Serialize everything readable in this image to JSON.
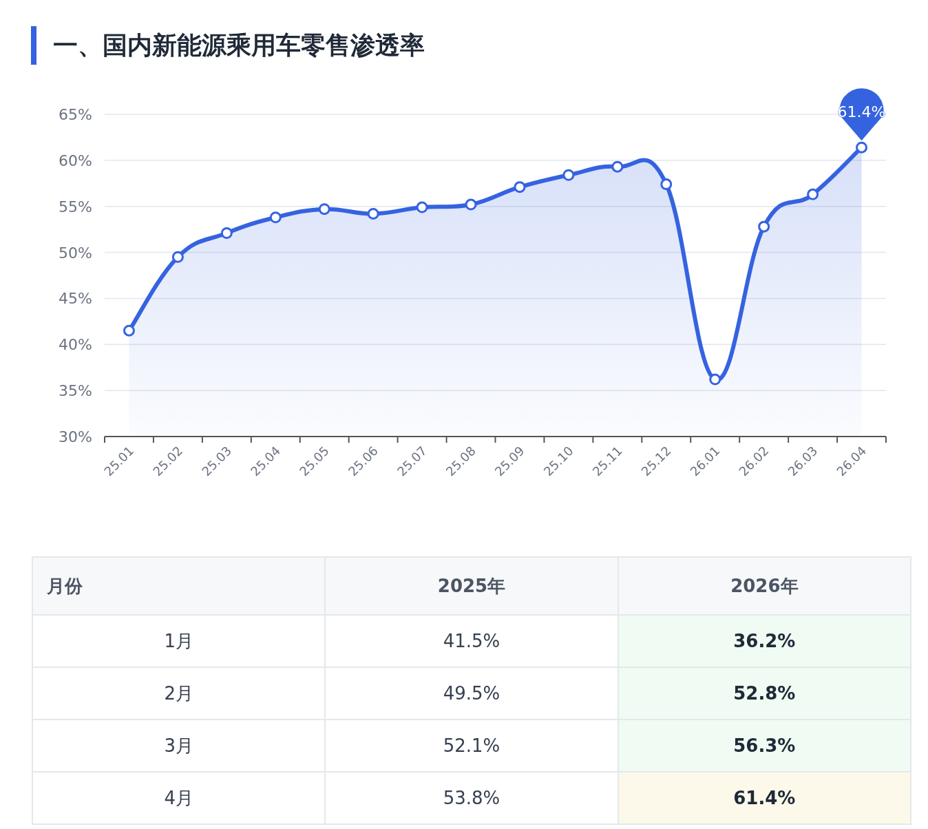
{
  "section": {
    "title": "一、国内新能源乘用车零售渗透率"
  },
  "chart": {
    "chart_data": {
      "type": "area",
      "categories": [
        "25.01",
        "25.02",
        "25.03",
        "25.04",
        "25.05",
        "25.06",
        "25.07",
        "25.08",
        "25.09",
        "25.10",
        "25.11",
        "25.12",
        "26.01",
        "26.02",
        "26.03",
        "26.04"
      ],
      "grid": true,
      "series": [
        {
          "color": "#3563e0",
          "values": [
            41.5,
            49.5,
            52.1,
            53.8,
            54.7,
            54.2,
            54.9,
            55.2,
            57.1,
            58.4,
            59.3,
            57.4,
            36.2,
            52.8,
            56.3,
            61.4
          ]
        }
      ],
      "ylim": [
        30,
        65
      ],
      "yticks": [
        {
          "value": 30,
          "label": "30%"
        },
        {
          "value": 35,
          "label": "35%"
        },
        {
          "value": 40,
          "label": "40%"
        },
        {
          "value": 45,
          "label": "45%"
        },
        {
          "value": 50,
          "label": "50%"
        },
        {
          "value": 55,
          "label": "55%"
        },
        {
          "value": 60,
          "label": "60%"
        },
        {
          "value": 65,
          "label": "65%"
        }
      ],
      "annotations": [
        "61.4%"
      ]
    }
  },
  "table": {
    "columns": [
      "月份",
      "2025年",
      "2026年"
    ],
    "rows": [
      {
        "month": "1月",
        "y2025": "41.5%",
        "y2026": "36.2%",
        "latest": false
      },
      {
        "month": "2月",
        "y2025": "49.5%",
        "y2026": "52.8%",
        "latest": false
      },
      {
        "month": "3月",
        "y2025": "52.1%",
        "y2026": "56.3%",
        "latest": false
      },
      {
        "month": "4月",
        "y2025": "53.8%",
        "y2026": "61.4%",
        "latest": true
      }
    ]
  }
}
